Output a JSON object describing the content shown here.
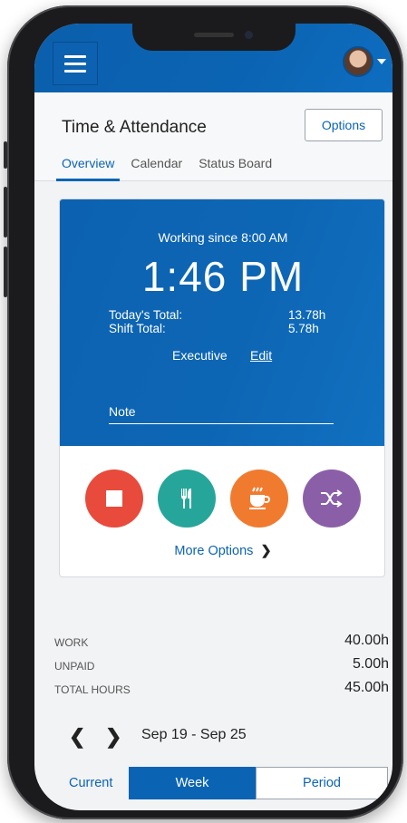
{
  "app": {
    "title": "Time & Attendance",
    "options_label": "Options",
    "tabs": [
      {
        "label": "Overview",
        "active": true
      },
      {
        "label": "Calendar",
        "active": false
      },
      {
        "label": "Status Board",
        "active": false
      }
    ]
  },
  "clock_card": {
    "working_since": "Working since 8:00 AM",
    "current_time": "1:46 PM",
    "todays_total_label": "Today's Total:",
    "todays_total_value": "13.78h",
    "shift_total_label": "Shift Total:",
    "shift_total_value": "5.78h",
    "role": "Executive",
    "edit_label": "Edit",
    "note_label": "Note",
    "actions": [
      {
        "name": "stop",
        "icon": "stop-icon",
        "color": "#e84b3c"
      },
      {
        "name": "meal",
        "icon": "fork-knife-icon",
        "color": "#26a69a"
      },
      {
        "name": "break",
        "icon": "coffee-cup-icon",
        "color": "#f07b2f"
      },
      {
        "name": "transfer",
        "icon": "shuffle-icon",
        "color": "#8b5fa8"
      }
    ],
    "more_options_label": "More Options"
  },
  "totals": [
    {
      "label": "WORK",
      "value": "40.00h"
    },
    {
      "label": "UNPAID",
      "value": "5.00h"
    },
    {
      "label": "TOTAL HOURS",
      "value": "45.00h"
    }
  ],
  "period": {
    "range": "Sep 19 - Sep 25",
    "segments": {
      "current": "Current",
      "week": "Week",
      "period": "Period"
    },
    "selected": "Week"
  },
  "colors": {
    "brand_blue": "#0b64b3",
    "background": "#f2f3f5"
  }
}
